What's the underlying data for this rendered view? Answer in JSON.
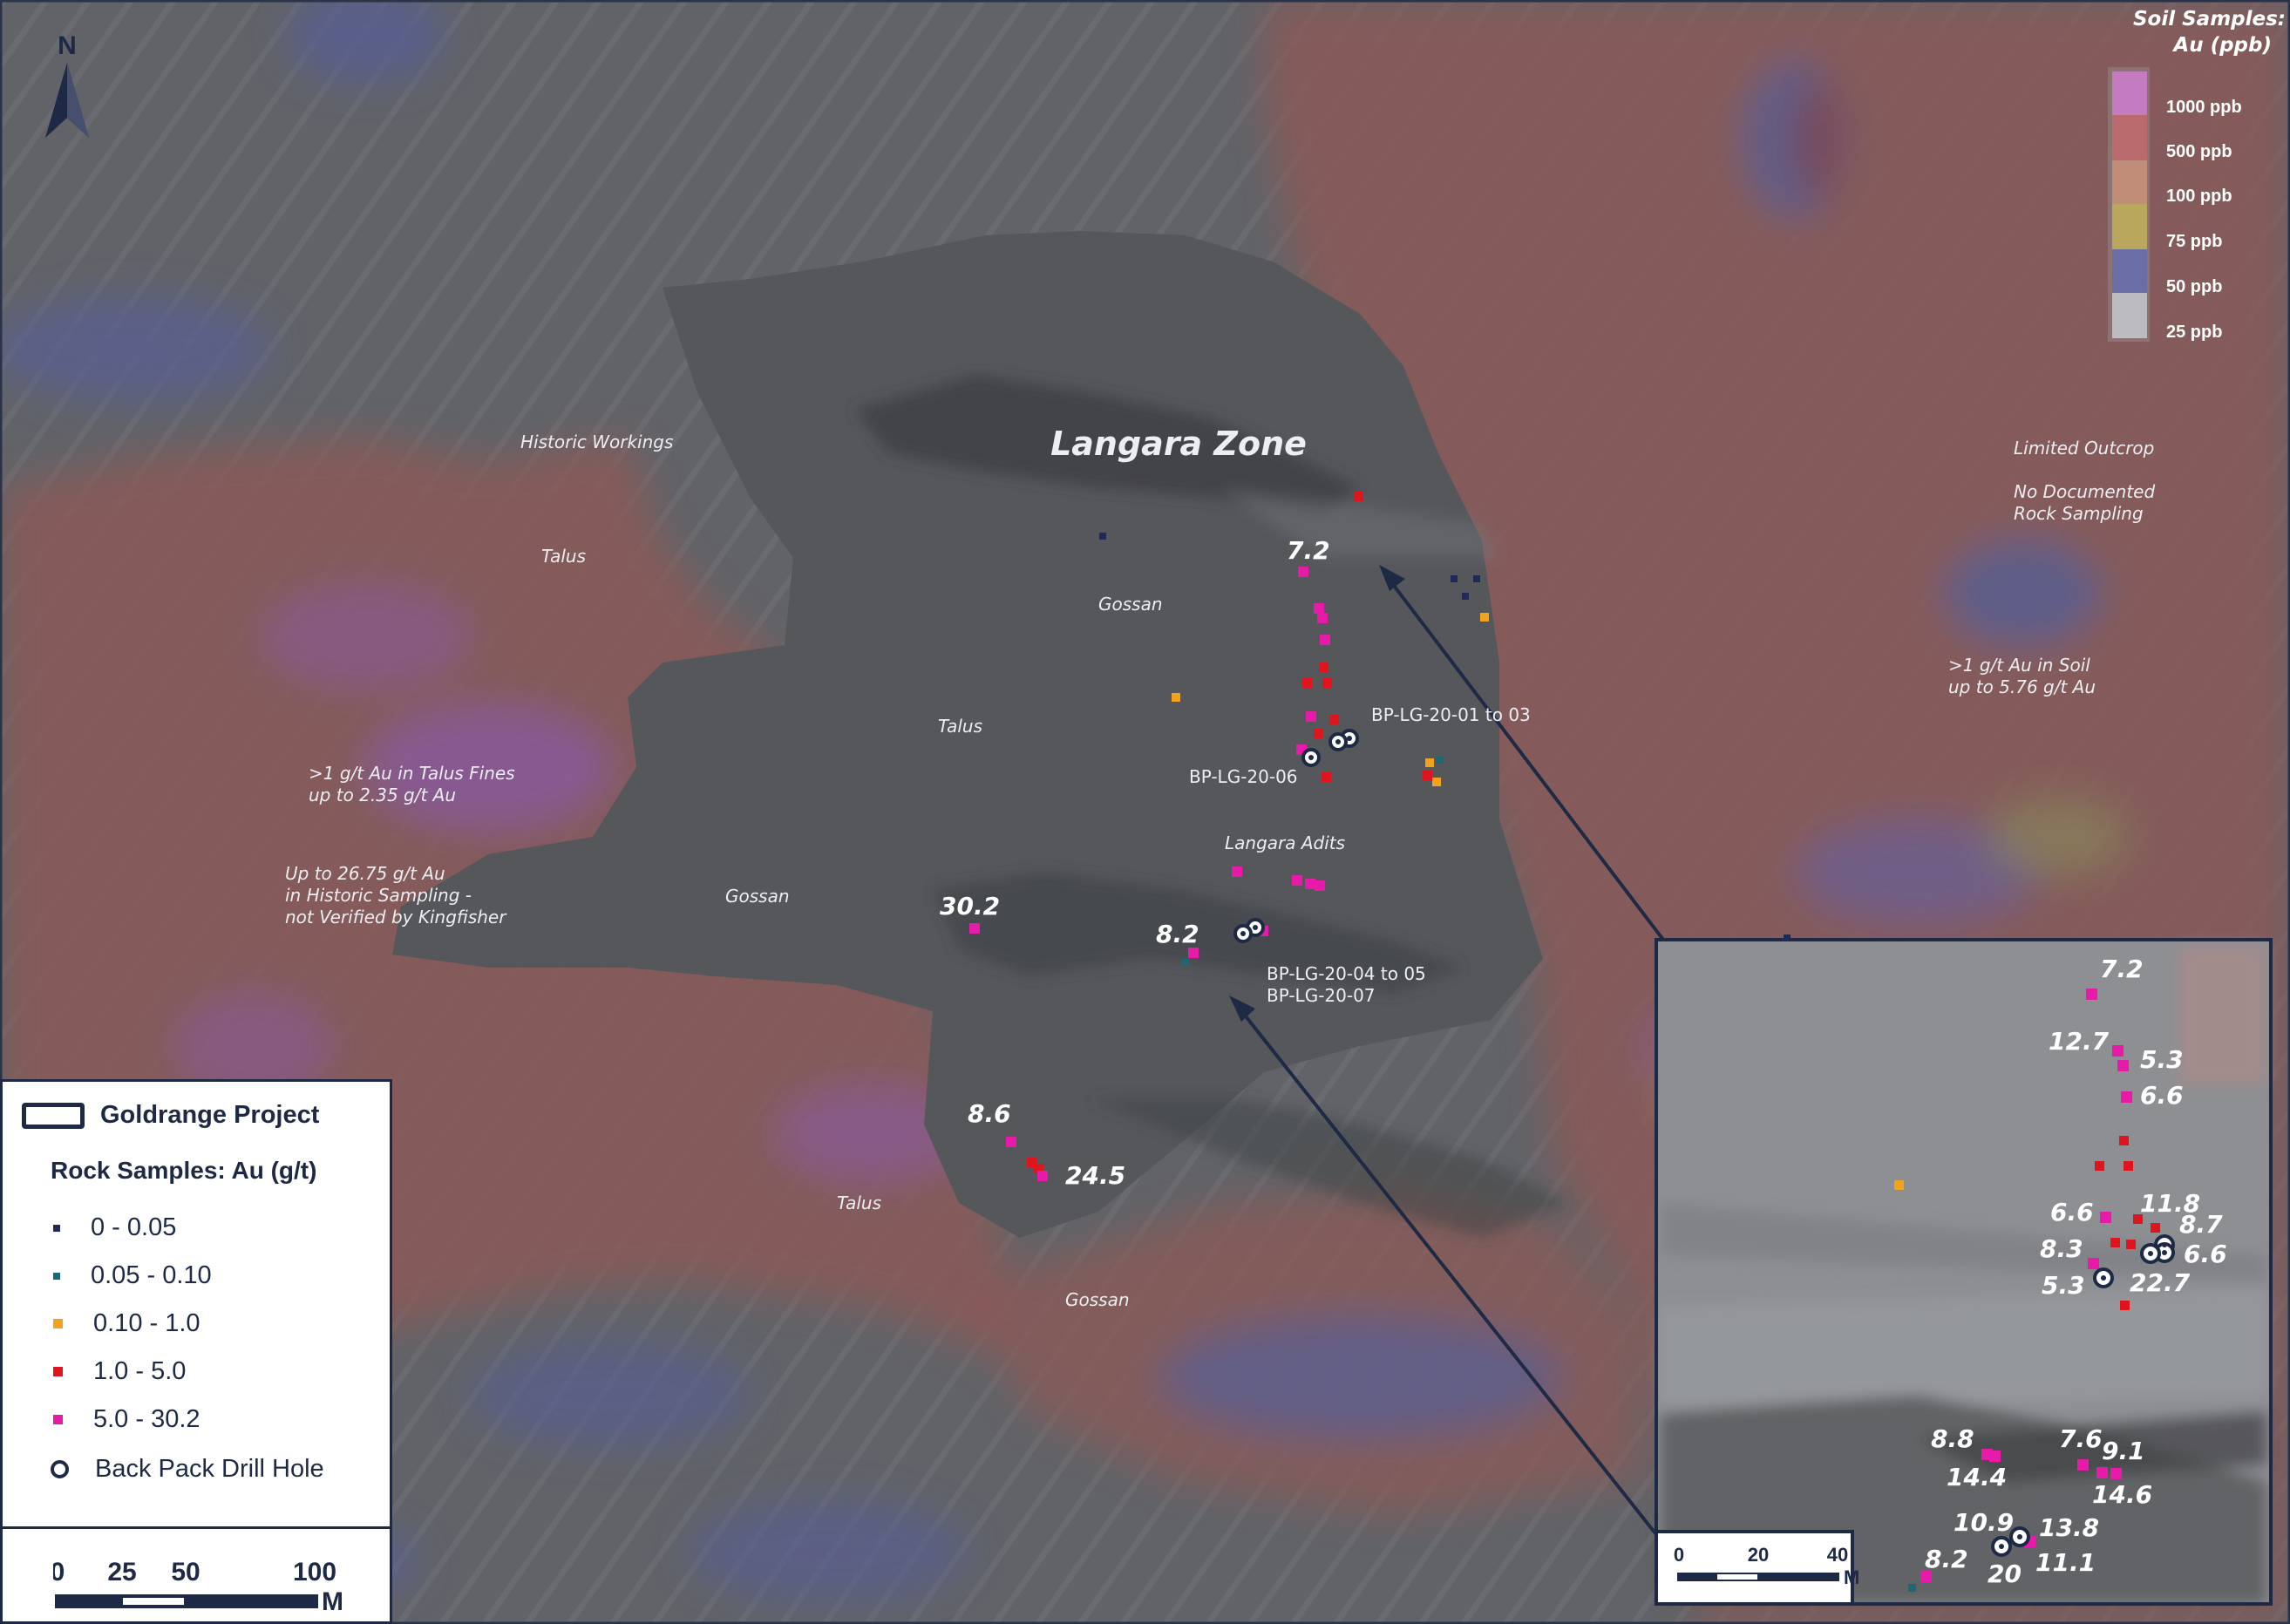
{
  "north_arrow": {
    "label": "N"
  },
  "map_title": "Langara Zone",
  "map_labels": {
    "historic_workings": "Historic Workings",
    "talus_1": "Talus",
    "talus_2": "Talus",
    "talus_3": "Talus",
    "gossan_1": "Gossan",
    "gossan_2": "Gossan",
    "gossan_3": "Gossan",
    "langara_adits": "Langara Adits",
    "limited_outcrop": "Limited Outcrop",
    "no_documented_1": "No Documented",
    "no_documented_2": "Rock Sampling",
    "soil_note_1": ">1 g/t Au in Soil",
    "soil_note_2": "up to 5.76 g/t Au",
    "talus_note_1": ">1 g/t Au in Talus Fines",
    "talus_note_2": "up to 2.35 g/t Au",
    "hist_note_1": "Up to 26.75 g/t Au",
    "hist_note_2": "in Historic Sampling -",
    "hist_note_3": "not Verified by Kingfisher",
    "drill_label_1": "BP-LG-20-01 to 03",
    "drill_label_2": "BP-LG-20-06",
    "drill_label_3": "BP-LG-20-04 to 05",
    "drill_label_4": "BP-LG-20-07"
  },
  "main_values": {
    "v1": "7.2",
    "v2": "30.2",
    "v3": "8.2",
    "v4": "8.6",
    "v5": "24.5"
  },
  "inset_values": {
    "v1": "7.2",
    "v2": "12.7",
    "v3": "5.3",
    "v4": "6.6",
    "v5": "11.8",
    "v6": "6.6",
    "v7": "8.7",
    "v8": "8.3",
    "v9": "6.6",
    "v10": "5.3",
    "v11": "22.7",
    "v12": "8.8",
    "v13": "7.6",
    "v14": "9.1",
    "v15": "14.4",
    "v16": "14.6",
    "v17": "10.9",
    "v18": "13.8",
    "v19": "11.1",
    "v20": "20",
    "v21": "8.2"
  },
  "inset_scale": {
    "t0": "0",
    "t1": "20",
    "t2": "40",
    "unit": "M"
  },
  "soil_legend": {
    "title_1": "Soil Samples:",
    "title_2": "Au (ppb)",
    "items": [
      {
        "label": "1000 ppb",
        "color": "#c47bbf"
      },
      {
        "label": "500 ppb",
        "color": "#b86a6d"
      },
      {
        "label": "100 ppb",
        "color": "#c08d79"
      },
      {
        "label": "75 ppb",
        "color": "#b8a75c"
      },
      {
        "label": "50 ppb",
        "color": "#6b6ea6"
      },
      {
        "label": "25 ppb",
        "color": "#bcbcc0"
      }
    ]
  },
  "legend": {
    "project_label": "Goldrange Project",
    "rock_title": "Rock Samples: Au (g/t)",
    "items": [
      {
        "label": "0 - 0.05",
        "color": "#1e2a5a"
      },
      {
        "label": "0.05 - 0.10",
        "color": "#1a6a72"
      },
      {
        "label": "0.10 - 1.0",
        "color": "#f2a21c"
      },
      {
        "label": "1.0 - 5.0",
        "color": "#e0141c"
      },
      {
        "label": "5.0 - 30.2",
        "color": "#e81aaa"
      }
    ],
    "hole_label": "Back Pack Drill Hole"
  },
  "scale": {
    "t0": "0",
    "t1": "25",
    "t2": "50",
    "t3": "100",
    "unit": "M"
  }
}
